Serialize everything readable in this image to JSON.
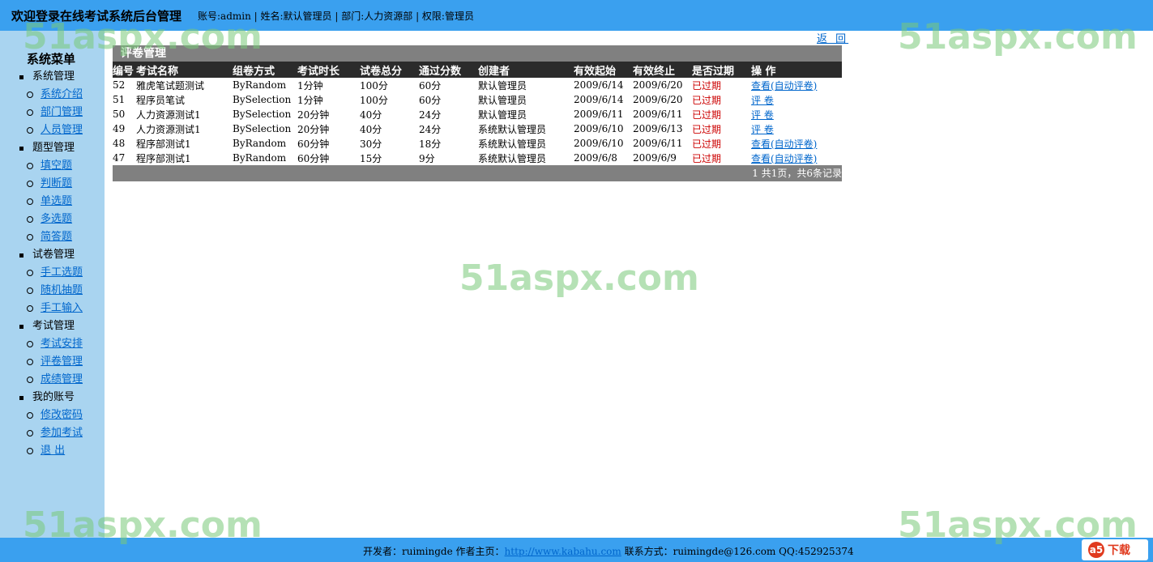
{
  "header": {
    "title": "欢迎登录在线考试系统后台管理",
    "account_info": "账号:admin | 姓名:默认管理员 | 部门:人力资源部 | 权限:管理员"
  },
  "sidebar": {
    "title": "系统菜单",
    "groups": [
      {
        "label": "系统管理",
        "items": [
          "系统介绍",
          "部门管理",
          "人员管理"
        ]
      },
      {
        "label": "题型管理",
        "items": [
          "填空题",
          "判断题",
          "单选题",
          "多选题",
          "简答题"
        ]
      },
      {
        "label": "试卷管理",
        "items": [
          "手工选题",
          "随机抽题",
          "手工输入"
        ]
      },
      {
        "label": "考试管理",
        "items": [
          "考试安排",
          "评卷管理",
          "成绩管理"
        ]
      },
      {
        "label": "我的账号",
        "items": [
          "修改密码",
          "参加考试",
          "退  出"
        ]
      }
    ]
  },
  "main": {
    "back_label": "返 回",
    "panel_title": "评卷管理",
    "columns": [
      "编号",
      "考试名称",
      "组卷方式",
      "考试时长",
      "试卷总分",
      "通过分数",
      "创建者",
      "有效起始",
      "有效终止",
      "是否过期",
      "操  作"
    ],
    "rows": [
      [
        "52",
        "雅虎笔试题测试",
        "ByRandom",
        "1分钟",
        "100分",
        "60分",
        "默认管理员",
        "2009/6/14",
        "2009/6/20",
        "已过期",
        "查看(自动评卷)"
      ],
      [
        "51",
        "程序员笔试",
        "BySelection",
        "1分钟",
        "100分",
        "60分",
        "默认管理员",
        "2009/6/14",
        "2009/6/20",
        "已过期",
        "评  卷"
      ],
      [
        "50",
        "人力资源测试1",
        "BySelection",
        "20分钟",
        "40分",
        "24分",
        "默认管理员",
        "2009/6/11",
        "2009/6/11",
        "已过期",
        "评  卷"
      ],
      [
        "49",
        "人力资源测试1",
        "BySelection",
        "20分钟",
        "40分",
        "24分",
        "系统默认管理员",
        "2009/6/10",
        "2009/6/13",
        "已过期",
        "评  卷"
      ],
      [
        "48",
        "程序部测试1",
        "ByRandom",
        "60分钟",
        "30分",
        "18分",
        "系统默认管理员",
        "2009/6/10",
        "2009/6/11",
        "已过期",
        "查看(自动评卷)"
      ],
      [
        "47",
        "程序部测试1",
        "ByRandom",
        "60分钟",
        "15分",
        "9分",
        "系统默认管理员",
        "2009/6/8",
        "2009/6/9",
        "已过期",
        "查看(自动评卷)"
      ]
    ],
    "pager": "1   共1页，共6条记录"
  },
  "footer": {
    "developer": "开发者：ruimingde  作者主页：",
    "homepage": "http://www.kabahu.com",
    "contact": "  联系方式：ruimingde@126.com QQ:452925374"
  },
  "watermark": "51aspx.com",
  "download_logo": {
    "badge": "a5",
    "label": "下载"
  }
}
